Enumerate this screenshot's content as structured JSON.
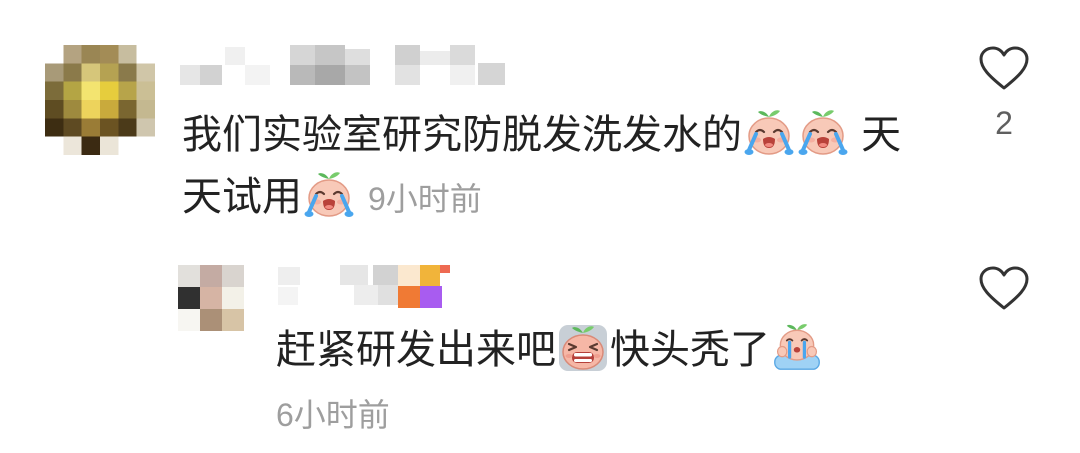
{
  "colors": {
    "background": "#ffffff",
    "text": "#222222",
    "muted": "#9e9e9e",
    "count": "#5f5f5f",
    "icon": "#333333"
  },
  "comments": [
    {
      "text": [
        "我们实验室研究防脱发洗发水的",
        " 天天试用"
      ],
      "emojis": [
        "crying-face-icon",
        "crying-face-icon",
        "crying-face-icon"
      ],
      "time": "9小时前",
      "like_icon": "heart-outline-icon",
      "like_count": "2",
      "replies": [
        {
          "text": [
            "赶紧研发出来吧",
            "快头秃了"
          ],
          "emojis": [
            "grimace-face-icon",
            "sobbing-face-icon"
          ],
          "time": "6小时前",
          "like_icon": "heart-outline-icon"
        }
      ]
    }
  ]
}
